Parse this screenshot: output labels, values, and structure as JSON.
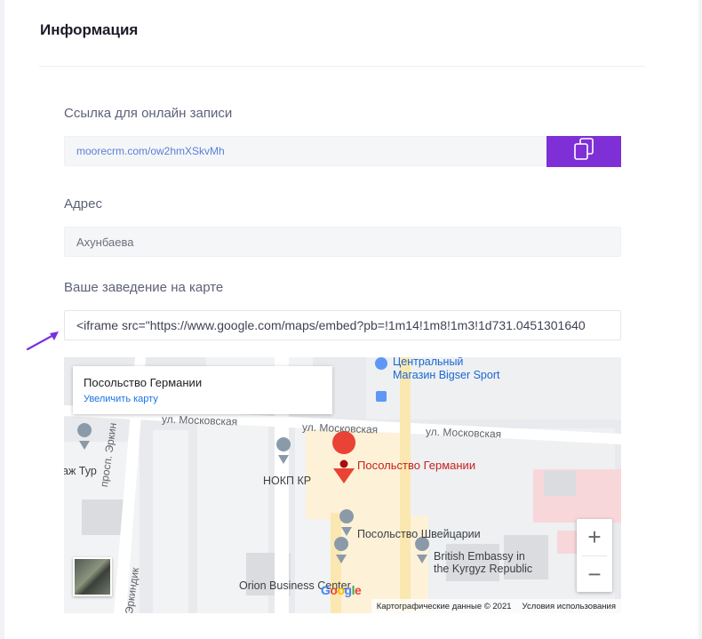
{
  "section": {
    "title": "Информация"
  },
  "booking_link": {
    "label": "Ссылка для онлайн записи",
    "value": "moorecrm.com/ow2hmXSkvMh",
    "copy_icon": "copy-icon",
    "accent": "#7e30d6"
  },
  "address": {
    "label": "Адрес",
    "value": "Ахунбаева"
  },
  "map_embed": {
    "label": "Ваше заведение на карте",
    "value": "<iframe src=\"https://www.google.com/maps/embed?pb=!1m14!1m8!1m3!1d731.0451301640"
  },
  "map": {
    "card_title": "Посольство Германии",
    "card_link": "Увеличить карту",
    "labels": {
      "center_mall": "Центральный\nМагазин Bigser Sport",
      "street_left": "ул. Московская",
      "street_mid": "ул. Московская",
      "street_right": "ул. Московская",
      "tour": "аж Тур",
      "nokp": "НОКП КР",
      "germany": "Посольство Германии",
      "switzerland": "Посольство Швейцарии",
      "british_1": "British Embassy in",
      "british_2": "the Kyrgyz Republic",
      "prosp": "просп. Эркин",
      "erkindik": "Эркиндик",
      "orion": "Orion Business Center"
    },
    "zoom_in": "+",
    "zoom_out": "−",
    "attribution": "Картографические данные © 2021",
    "terms": "Условия использования",
    "logo": "Google"
  }
}
